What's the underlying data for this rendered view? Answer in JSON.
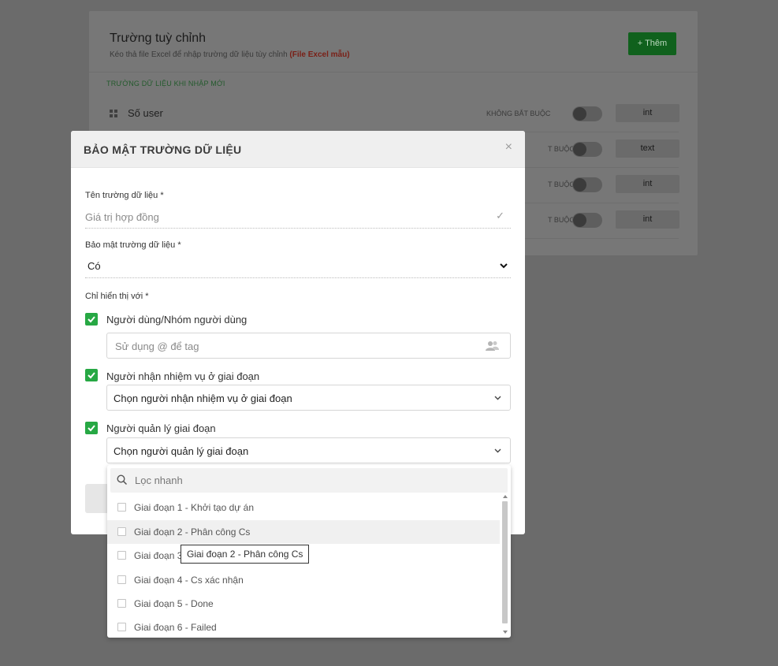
{
  "background": {
    "title": "Trường tuỳ chỉnh",
    "subtitle": "Kéo thả file Excel để nhập trường dữ liệu tùy chỉnh",
    "subtitle_link": "(File Excel mẫu)",
    "add_button": "+ Thêm",
    "section_label": "TRƯỜNG DỮ LIỆU KHI NHẬP MỚI",
    "rows": [
      {
        "name": "Số user",
        "required": "KHÔNG BẮT BUỘC",
        "type": "int"
      },
      {
        "name": "",
        "required": "T BUỘC",
        "type": "text"
      },
      {
        "name": "",
        "required": "T BUỘC",
        "type": "int"
      },
      {
        "name": "",
        "required": "T BUỘC",
        "type": "int"
      }
    ]
  },
  "modal": {
    "title": "BẢO MẬT TRƯỜNG DỮ LIỆU",
    "close": "×",
    "field_name_label": "Tên trường dữ liệu *",
    "field_name_value": "Giá trị hợp đồng",
    "security_label": "Bảo mật trường dữ liệu *",
    "security_value": "Có",
    "visible_to_label": "Chỉ hiển thị với *",
    "options": [
      {
        "label": "Người dùng/Nhóm người dùng",
        "checked": true,
        "input_placeholder": "Sử dụng @ để tag"
      },
      {
        "label": "Người nhận nhiệm vụ ở giai đoạn",
        "checked": true,
        "select_value": "Chọn người nhận nhiệm vụ ở giai đoạn"
      },
      {
        "label": "Người quản lý giai đoạn",
        "checked": true,
        "select_value": "Chọn người quản lý giai đoạn"
      }
    ]
  },
  "dropdown": {
    "search_placeholder": "Lọc nhanh",
    "items": [
      {
        "label": "Giai đoạn 1 - Khởi tạo dự án",
        "checked": false
      },
      {
        "label": "Giai đoạn 2 - Phân công Cs",
        "checked": false,
        "hover": true
      },
      {
        "label": "Giai đoạn 3",
        "checked": false
      },
      {
        "label": "Giai đoạn 4 - Cs xác nhận",
        "checked": false
      },
      {
        "label": "Giai đoạn 5 - Done",
        "checked": false
      },
      {
        "label": "Giai đoạn 6 - Failed",
        "checked": false
      }
    ]
  },
  "tooltip": "Giai đoạn 2 - Phân công Cs",
  "colors": {
    "accent_green": "#27a844",
    "overlay": "#6b6b6b"
  }
}
